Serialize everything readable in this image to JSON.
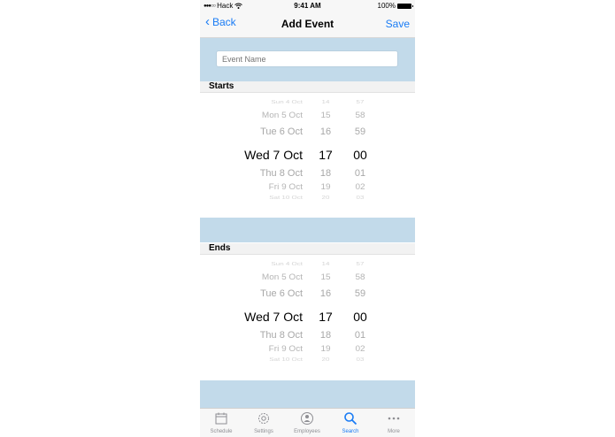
{
  "status_bar": {
    "carrier": "Hack",
    "time": "9:41 AM",
    "battery": "100%"
  },
  "nav": {
    "back_label": "Back",
    "title": "Add Event",
    "save_label": "Save"
  },
  "event_name": {
    "value": "",
    "placeholder": "Event Name"
  },
  "sections": {
    "starts": "Starts",
    "ends": "Ends"
  },
  "start_picker": {
    "rows": [
      {
        "date": "Sun 4 Oct",
        "hour": "14",
        "minute": "57"
      },
      {
        "date": "Mon 5 Oct",
        "hour": "15",
        "minute": "58"
      },
      {
        "date": "Tue 6 Oct",
        "hour": "16",
        "minute": "59"
      },
      {
        "date": "Wed 7 Oct",
        "hour": "17",
        "minute": "00"
      },
      {
        "date": "Thu 8 Oct",
        "hour": "18",
        "minute": "01"
      },
      {
        "date": "Fri 9 Oct",
        "hour": "19",
        "minute": "02"
      },
      {
        "date": "Sat 10 Oct",
        "hour": "20",
        "minute": "03"
      }
    ]
  },
  "end_picker": {
    "rows": [
      {
        "date": "Sun 4 Oct",
        "hour": "14",
        "minute": "57"
      },
      {
        "date": "Mon 5 Oct",
        "hour": "15",
        "minute": "58"
      },
      {
        "date": "Tue 6 Oct",
        "hour": "16",
        "minute": "59"
      },
      {
        "date": "Wed 7 Oct",
        "hour": "17",
        "minute": "00"
      },
      {
        "date": "Thu 8 Oct",
        "hour": "18",
        "minute": "01"
      },
      {
        "date": "Fri 9 Oct",
        "hour": "19",
        "minute": "02"
      },
      {
        "date": "Sat 10 Oct",
        "hour": "20",
        "minute": "03"
      }
    ]
  },
  "tabs": [
    {
      "label": "Schedule",
      "icon": "calendar-icon",
      "active": false
    },
    {
      "label": "Settings",
      "icon": "gear-icon",
      "active": false
    },
    {
      "label": "Employees",
      "icon": "person-icon",
      "active": false
    },
    {
      "label": "Search",
      "icon": "search-icon",
      "active": true
    },
    {
      "label": "More",
      "icon": "more-icon",
      "active": false
    }
  ],
  "colors": {
    "accent": "#1a7cf5",
    "section_blue": "#c2daea",
    "inactive_tab": "#8e8e93"
  }
}
